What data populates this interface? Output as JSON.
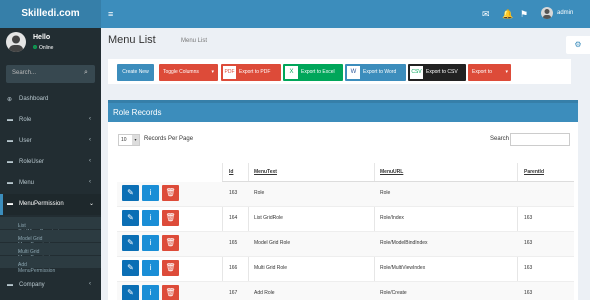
{
  "app": {
    "logo": "Skilledi.com",
    "menu_toggle": "≡",
    "username": "admin"
  },
  "nav_icons": [
    {
      "icon": "✉",
      "badge": "",
      "badge_color": "#00a65a"
    },
    {
      "icon": "🔔",
      "badge": "",
      "badge_color": "#f39c12"
    },
    {
      "icon": "⚑",
      "badge": "",
      "badge_color": "#dd4b39"
    }
  ],
  "user_panel": {
    "hello": "Hello",
    "status": "Online"
  },
  "search": {
    "placeholder": "Search...",
    "icon": "search-icon"
  },
  "sidebar": {
    "items": [
      {
        "label": "Dashboard",
        "icon": "⊕"
      },
      {
        "label": "Role",
        "icon": "▬"
      },
      {
        "label": "User",
        "icon": "▬"
      },
      {
        "label": "RoleUser",
        "icon": "▬"
      },
      {
        "label": "Menu",
        "icon": "▬"
      },
      {
        "label": "MenuPermission",
        "icon": "▬"
      }
    ],
    "subitems": [
      "List GridMenuPermission",
      "Model Grid MenuPermission",
      "Multi Grid MenuPermission",
      "Add MenuPermission"
    ],
    "last_item": {
      "label": "Company",
      "icon": "▬"
    }
  },
  "page": {
    "title": "Menu List",
    "subtitle": "Menu List"
  },
  "toolbar": {
    "create": "Create New",
    "toggle": "Toggle Columns",
    "pdf": "Export to PDF",
    "excel": "Export to Excel",
    "word": "Export to Word",
    "csv": "Export to CSV",
    "export": "Export to"
  },
  "box": {
    "title": "Role Records",
    "per_page_value": "10",
    "per_page_label": "Records Per Page",
    "search_label": "Search"
  },
  "table": {
    "headers": [
      "Id",
      "MenuText",
      "MenuURL",
      "ParentId"
    ],
    "rows": [
      [
        "163",
        "Role",
        "Role",
        ""
      ],
      [
        "164",
        "List GridRole",
        "Role/Index",
        "163"
      ],
      [
        "165",
        "Model Grid Role",
        "Role/ModelBindIndex",
        "163"
      ],
      [
        "166",
        "Multi Grid Role",
        "Role/MultiViewIndex",
        "163"
      ],
      [
        "167",
        "Add Role",
        "Role/Create",
        "163"
      ]
    ]
  },
  "colors": {
    "primary": "#3c8dbc",
    "dark": "#367fa9",
    "sidebar": "#222d32",
    "danger": "#dd4b39",
    "success": "#00a65a"
  }
}
